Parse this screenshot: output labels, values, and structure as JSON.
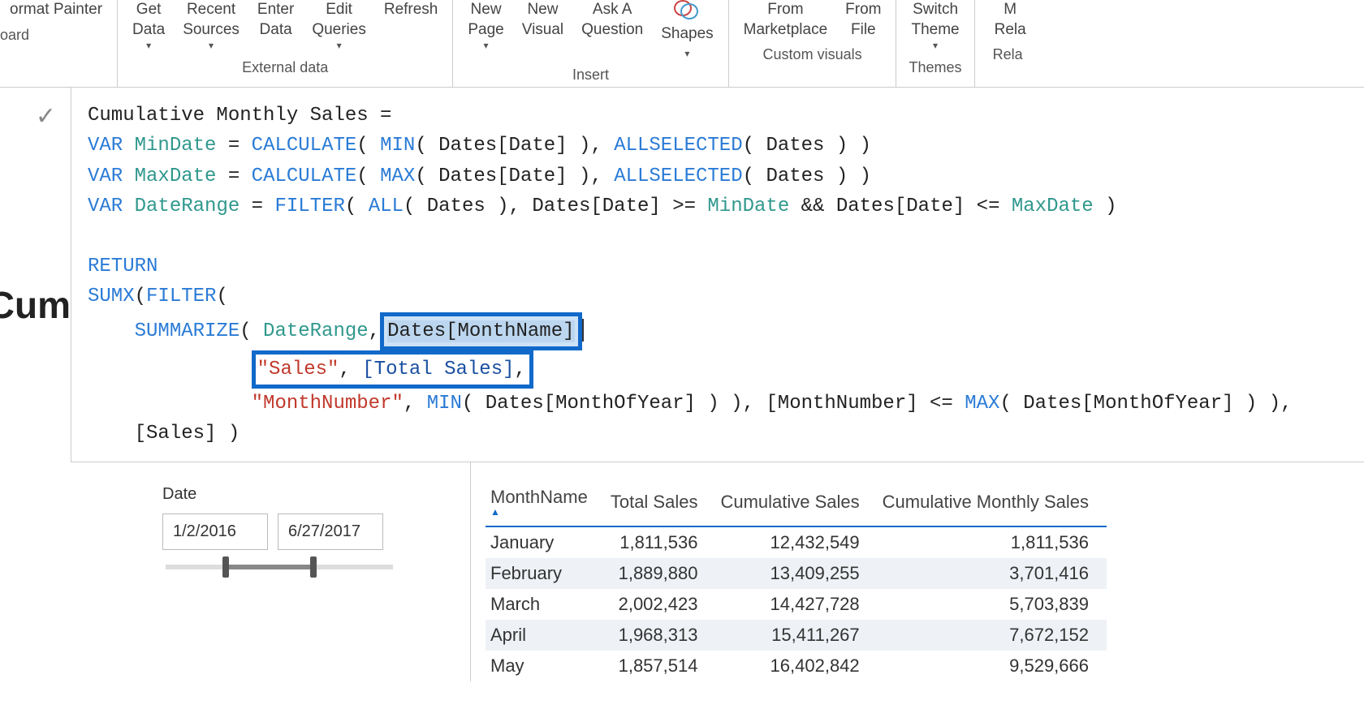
{
  "ribbon": {
    "clipboard": {
      "format_painter": "ormat Painter",
      "label": "oard"
    },
    "external_data": {
      "get_data": "Get\nData",
      "recent_sources": "Recent\nSources",
      "enter_data": "Enter\nData",
      "edit_queries": "Edit\nQueries",
      "refresh": "Refresh",
      "label": "External data"
    },
    "insert": {
      "new_page": "New\nPage",
      "new_visual": "New\nVisual",
      "ask_a_question": "Ask A\nQuestion",
      "shapes": "Shapes",
      "label": "Insert"
    },
    "custom_visuals": {
      "from_marketplace": "From\nMarketplace",
      "from_file": "From\nFile",
      "label": "Custom visuals"
    },
    "themes": {
      "switch_theme": "Switch\nTheme",
      "label": "Themes"
    },
    "relationships": {
      "manage": "M\nRela",
      "label": "Rela"
    }
  },
  "side": {
    "cum": "Cum"
  },
  "formula": {
    "line1": "Cumulative Monthly Sales =",
    "var": "VAR",
    "mindate": "MinDate",
    "maxdate": "MaxDate",
    "daterange": "DateRange",
    "calculate": "CALCULATE",
    "min": "MIN",
    "max": "MAX",
    "allselected": "ALLSELECTED",
    "filter": "FILTER",
    "all": "ALL",
    "return": "RETURN",
    "sumx": "SUMX",
    "summarize": "SUMMARIZE",
    "dates_date": "Dates[Date]",
    "dates": "Dates",
    "dates_monthname": "Dates[MonthName]",
    "sales_str": "\"Sales\"",
    "total_sales": "[Total Sales]",
    "monthnum_str": "\"MonthNumber\"",
    "dates_monthofyear": "Dates[MonthOfYear]",
    "monthnumber": "[MonthNumber]",
    "sales_col": "[Sales]"
  },
  "slicer": {
    "caption": "Date",
    "start": "1/2/2016",
    "end": "6/27/2017"
  },
  "table": {
    "headers": {
      "monthname": "MonthName",
      "total_sales": "Total Sales",
      "cumulative_sales": "Cumulative Sales",
      "cumulative_monthly_sales": "Cumulative Monthly Sales"
    },
    "rows": [
      {
        "month": "January",
        "total": "1,811,536",
        "cum": "12,432,549",
        "cms": "1,811,536"
      },
      {
        "month": "February",
        "total": "1,889,880",
        "cum": "13,409,255",
        "cms": "3,701,416"
      },
      {
        "month": "March",
        "total": "2,002,423",
        "cum": "14,427,728",
        "cms": "5,703,839"
      },
      {
        "month": "April",
        "total": "1,968,313",
        "cum": "15,411,267",
        "cms": "7,672,152"
      },
      {
        "month": "May",
        "total": "1,857,514",
        "cum": "16,402,842",
        "cms": "9,529,666"
      }
    ]
  },
  "chart_data": {
    "type": "table",
    "title": "Cumulative Monthly Sales",
    "columns": [
      "MonthName",
      "Total Sales",
      "Cumulative Sales",
      "Cumulative Monthly Sales"
    ],
    "rows": [
      [
        "January",
        1811536,
        12432549,
        1811536
      ],
      [
        "February",
        1889880,
        13409255,
        3701416
      ],
      [
        "March",
        2002423,
        14427728,
        5703839
      ],
      [
        "April",
        1968313,
        15411267,
        7672152
      ],
      [
        "May",
        1857514,
        16402842,
        9529666
      ]
    ]
  }
}
